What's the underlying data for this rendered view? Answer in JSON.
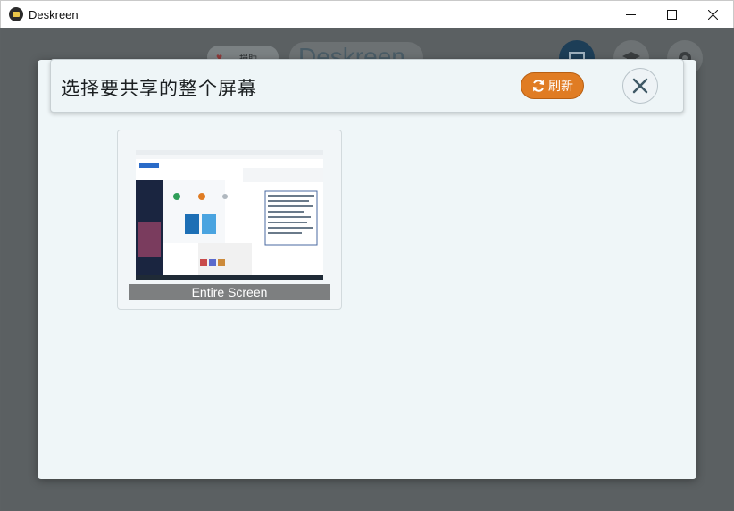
{
  "window": {
    "title": "Deskreen",
    "controls": {
      "minimize_icon": "minimize-icon",
      "maximize_icon": "maximize-icon",
      "close_icon": "close-icon"
    }
  },
  "background": {
    "donate_label": "捐助",
    "logo_text": "Deskreen"
  },
  "dialog": {
    "title": "选择要共享的整个屏幕",
    "refresh_label": "刷新",
    "refresh_icon": "refresh-icon",
    "close_icon": "close-icon",
    "sources": [
      {
        "label": "Entire Screen"
      }
    ]
  },
  "colors": {
    "accent": "#e07c23",
    "overlay": "#5c6163",
    "dialog_bg": "#eff6f8",
    "label_bg": "#7d7f80"
  }
}
